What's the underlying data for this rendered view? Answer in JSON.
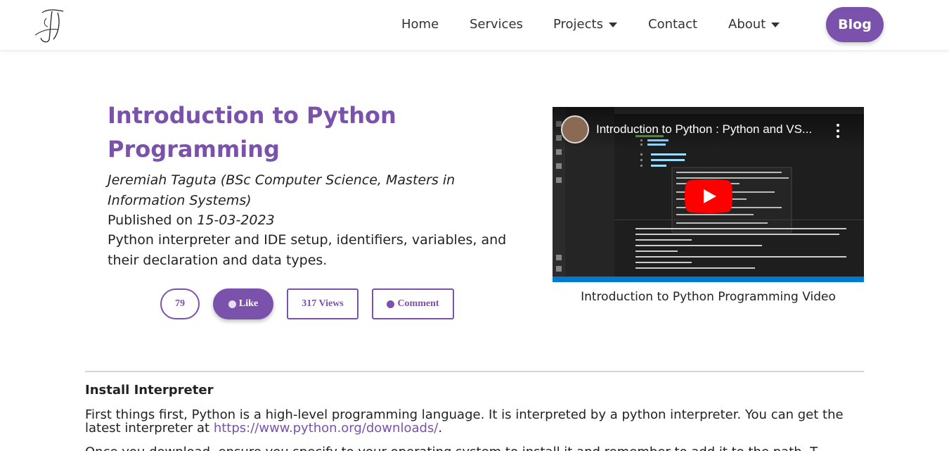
{
  "nav": {
    "items": [
      {
        "label": "Home",
        "dropdown": false
      },
      {
        "label": "Services",
        "dropdown": false
      },
      {
        "label": "Projects",
        "dropdown": true
      },
      {
        "label": "Contact",
        "dropdown": false
      },
      {
        "label": "About",
        "dropdown": true
      }
    ],
    "blog_label": "Blog"
  },
  "article": {
    "title": "Introduction to Python Programming",
    "author": "Jeremiah Taguta (BSc Computer Science, Masters in Information Systems)",
    "published_prefix": "Published on",
    "published_date": "15-03-2023",
    "summary": "Python interpreter and IDE setup, identifiers, variables, and their declaration and data types."
  },
  "actions": {
    "count": "79",
    "like_label": "Like",
    "views_label": "317 Views",
    "comment_label": "Comment"
  },
  "video": {
    "title": "Introduction to Python : Python and VS...",
    "caption": "Introduction to Python Programming Video"
  },
  "content": {
    "heading": "Install Interpreter",
    "para1_text": "First things first, Python is a high-level programming language. It is interpreted by a python interpreter. You can get the latest interpreter at",
    "para1_link": "https://www.python.org/downloads/",
    "para1_end": ".",
    "para2_text": "Once you download, ensure you specify to your operating system to install it and remember to add it to the path. T"
  },
  "colors": {
    "accent": "#7b52ab",
    "youtube_red": "#ff0000"
  }
}
